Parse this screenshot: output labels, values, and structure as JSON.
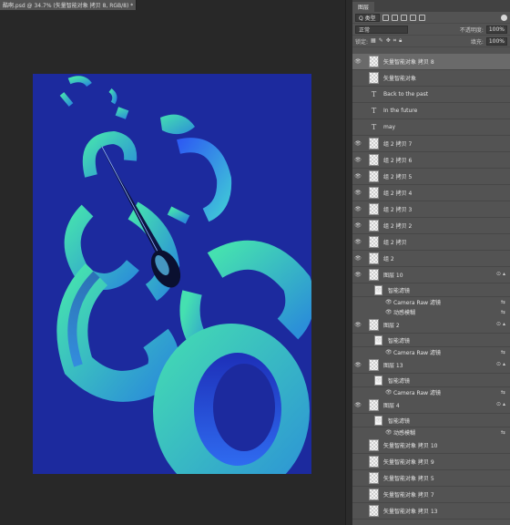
{
  "document": {
    "tab_title": "酷啊.psd @ 34.7% (矢量智能对象 拷贝 8, RGB/8) *",
    "close_glyph": "×"
  },
  "panel": {
    "tab_label": "图层",
    "filter_kind": "Q 类型",
    "blend_mode": "正常",
    "opacity_label": "不透明度:",
    "opacity_value": "100%",
    "lock_label": "锁定:",
    "fill_label": "填充:",
    "fill_value": "100%"
  },
  "layers": [
    {
      "type": "layer",
      "name": "矢量智能对象 拷贝 8",
      "visible": true,
      "thumb": "checker",
      "selected": true
    },
    {
      "type": "layer",
      "name": "矢量智能对象",
      "visible": false,
      "thumb": "checker"
    },
    {
      "type": "layer",
      "name": "Back to the past",
      "visible": false,
      "thumb": "text"
    },
    {
      "type": "layer",
      "name": "In the future",
      "visible": false,
      "thumb": "text"
    },
    {
      "type": "layer",
      "name": "may",
      "visible": false,
      "thumb": "text"
    },
    {
      "type": "layer",
      "name": "组 2 拷贝 7",
      "visible": true,
      "thumb": "checker"
    },
    {
      "type": "layer",
      "name": "组 2 拷贝 6",
      "visible": true,
      "thumb": "checker"
    },
    {
      "type": "layer",
      "name": "组 2 拷贝 5",
      "visible": true,
      "thumb": "checker"
    },
    {
      "type": "layer",
      "name": "组 2 拷贝 4",
      "visible": true,
      "thumb": "checker"
    },
    {
      "type": "layer",
      "name": "组 2 拷贝 3",
      "visible": true,
      "thumb": "checker"
    },
    {
      "type": "layer",
      "name": "组 2 拷贝 2",
      "visible": true,
      "thumb": "checker"
    },
    {
      "type": "layer",
      "name": "组 2 拷贝",
      "visible": true,
      "thumb": "checker"
    },
    {
      "type": "layer",
      "name": "组 2",
      "visible": true,
      "thumb": "checker"
    },
    {
      "type": "layer",
      "name": "图层 10",
      "visible": true,
      "thumb": "checker",
      "fx": true
    },
    {
      "type": "filter",
      "name": "智能滤镜",
      "thumb": "white"
    },
    {
      "type": "effect",
      "name": "Camera Raw 滤镜"
    },
    {
      "type": "effect",
      "name": "动感模糊"
    },
    {
      "type": "layer",
      "name": "图层 2",
      "visible": true,
      "thumb": "checker",
      "fx": true
    },
    {
      "type": "filter",
      "name": "智能滤镜",
      "thumb": "white"
    },
    {
      "type": "effect",
      "name": "Camera Raw 滤镜"
    },
    {
      "type": "layer",
      "name": "图层 13",
      "visible": true,
      "thumb": "checker",
      "fx": true
    },
    {
      "type": "filter",
      "name": "智能滤镜",
      "thumb": "white"
    },
    {
      "type": "effect",
      "name": "Camera Raw 滤镜"
    },
    {
      "type": "layer",
      "name": "图层 4",
      "visible": true,
      "thumb": "checker",
      "fx": true
    },
    {
      "type": "filter",
      "name": "智能滤镜",
      "thumb": "white"
    },
    {
      "type": "effect",
      "name": "动感模糊"
    },
    {
      "type": "layer",
      "name": "矢量智能对象 拷贝 10",
      "visible": false,
      "thumb": "checker"
    },
    {
      "type": "layer",
      "name": "矢量智能对象 拷贝 9",
      "visible": false,
      "thumb": "checker"
    },
    {
      "type": "layer",
      "name": "矢量智能对象 拷贝 5",
      "visible": false,
      "thumb": "checker"
    },
    {
      "type": "layer",
      "name": "矢量智能对象 拷贝 7",
      "visible": false,
      "thumb": "checker"
    },
    {
      "type": "layer",
      "name": "矢量智能对象 拷贝 13",
      "visible": false,
      "thumb": "checker"
    }
  ],
  "colors": {
    "artboard_bg": "#1c2a9e",
    "ring_teal": "#3fd7b0",
    "ring_blue": "#2f6bf0"
  }
}
